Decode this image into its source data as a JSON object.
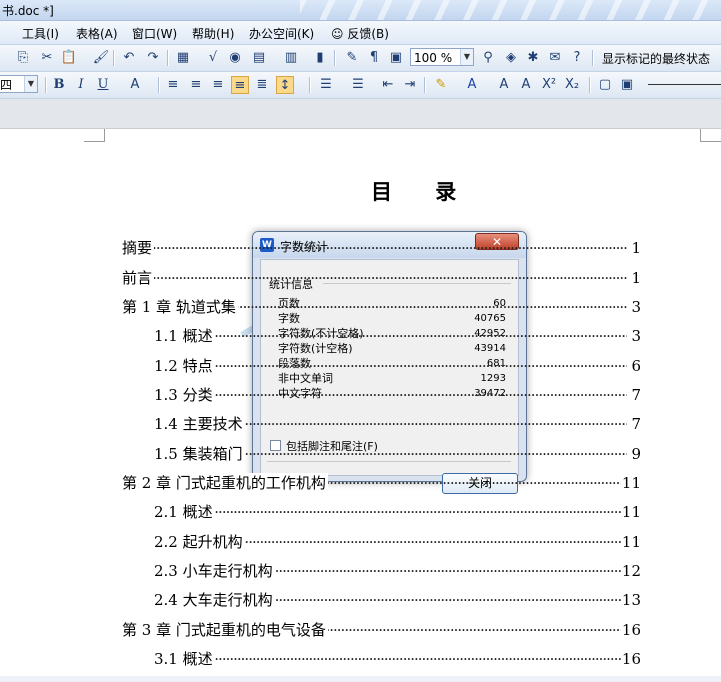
{
  "window": {
    "title": "书.doc *]"
  },
  "menu": [
    "工具(I)",
    "表格(A)",
    "窗口(W)",
    "帮助(H)",
    "办公空间(K)",
    "反馈(B)"
  ],
  "toolbar": {
    "zoom": "100 %",
    "markup_state": "显示标记的最终状态",
    "font_size": "四"
  },
  "toc": {
    "title": "目 录",
    "rows": [
      {
        "label": "摘要",
        "page": "1"
      },
      {
        "label": "前言",
        "page": "1"
      },
      {
        "label": "第 1 章   轨道式集",
        "page": "3"
      },
      {
        "label": "1.1   概述",
        "page": "3"
      },
      {
        "label": "1.2   特点",
        "page": "6"
      },
      {
        "label": "1.3 分类",
        "page": "7"
      },
      {
        "label": "1.4 主要技术",
        "page": "7"
      },
      {
        "label": "1.5   集装箱门",
        "page": "9"
      },
      {
        "label": "第 2 章   门式起重机的工作机构",
        "page": "11"
      },
      {
        "label": "2.1   概述",
        "page": "11"
      },
      {
        "label": "2.2   起升机构",
        "page": "11"
      },
      {
        "label": "2.3   小车走行机构",
        "page": "12"
      },
      {
        "label": "2.4   大车走行机构",
        "page": "13"
      },
      {
        "label": "第 3 章   门式起重机的电气设备",
        "page": "16"
      },
      {
        "label": "3.1   概述",
        "page": "16"
      }
    ]
  },
  "dialog": {
    "title": "字数统计",
    "group_label": "统计信息",
    "stats": [
      {
        "key": "页数",
        "value": "60"
      },
      {
        "key": "字数",
        "value": "40765"
      },
      {
        "key": "字符数(不计空格)",
        "value": "42952"
      },
      {
        "key": "字符数(计空格)",
        "value": "43914"
      },
      {
        "key": "段落数",
        "value": "681"
      },
      {
        "key": "非中文单词",
        "value": "1293"
      },
      {
        "key": "中文字符",
        "value": "39472"
      }
    ],
    "checkbox_label": "包括脚注和尾注(F)",
    "close_button": "关闭"
  }
}
